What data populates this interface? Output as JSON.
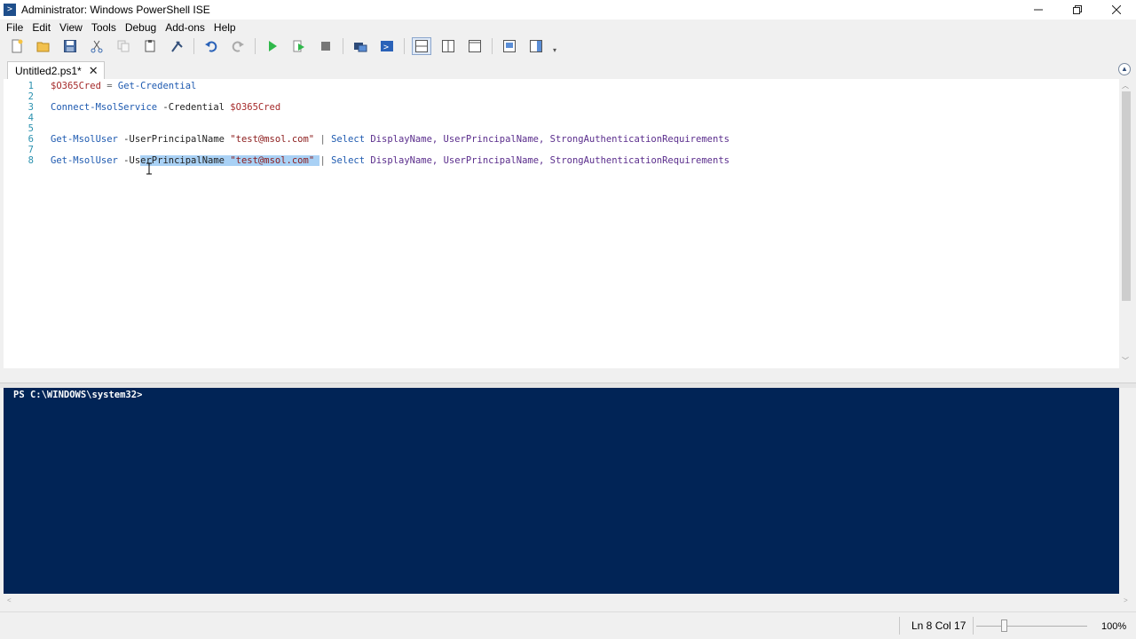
{
  "window": {
    "title": "Administrator: Windows PowerShell ISE",
    "app_icon": "powershell-icon",
    "minimize_icon": "minimize-icon",
    "restore_icon": "restore-icon",
    "close_icon": "close-icon"
  },
  "menu": {
    "items": [
      "File",
      "Edit",
      "View",
      "Tools",
      "Debug",
      "Add-ons",
      "Help"
    ]
  },
  "toolbar": {
    "icons": [
      "new-script-icon",
      "open-icon",
      "save-icon",
      "cut-icon",
      "copy-icon",
      "paste-icon",
      "clear-console-icon",
      "undo-icon",
      "redo-icon",
      "run-script-icon",
      "run-selection-icon",
      "stop-icon",
      "remote-powershell-icon",
      "start-powershell-icon",
      "show-script-pane-top-icon",
      "show-script-pane-right-icon",
      "show-script-pane-maximized-icon",
      "show-command-window-icon",
      "show-command-addon-icon"
    ]
  },
  "tabs": [
    {
      "label": "Untitled2.ps1*",
      "active": true
    }
  ],
  "editor": {
    "line_numbers": [
      "1",
      "2",
      "3",
      "4",
      "5",
      "6",
      "7",
      "8"
    ],
    "lines": {
      "l1_var": "$O365Cred",
      "l1_eq": " = ",
      "l1_cmd": "Get-Credential",
      "l3_cmd": "Connect-MsolService",
      "l3_param": " -Credential ",
      "l3_var": "$O365Cred",
      "l6_cmd": "Get-MsolUser",
      "l6_param": " -UserPrincipalName ",
      "l6_str": "\"test@msol.com\"",
      "l6_pipe": " | ",
      "l6_select": "Select",
      "l6_args": " DisplayName, UserPrincipalName, StrongAuthenticationRequirements",
      "l8_cmd": "Get-MsolUser",
      "l8_param_a": " -Us",
      "l8_param_b": "erPrincipalName ",
      "l8_str": "\"test@msol.com\"",
      "l8_space": " ",
      "l8_pipe": "| ",
      "l8_select": "Select",
      "l8_args": " DisplayName, UserPrincipalName, StrongAuthenticationRequirements"
    }
  },
  "console": {
    "prompt": "PS C:\\WINDOWS\\system32>"
  },
  "status": {
    "position": "Ln 8  Col 17",
    "zoom": "100%",
    "zoom_percent": 100
  },
  "colors": {
    "console_bg": "#012456",
    "selection": "#a9d1f5",
    "line_number": "#2b91af"
  }
}
